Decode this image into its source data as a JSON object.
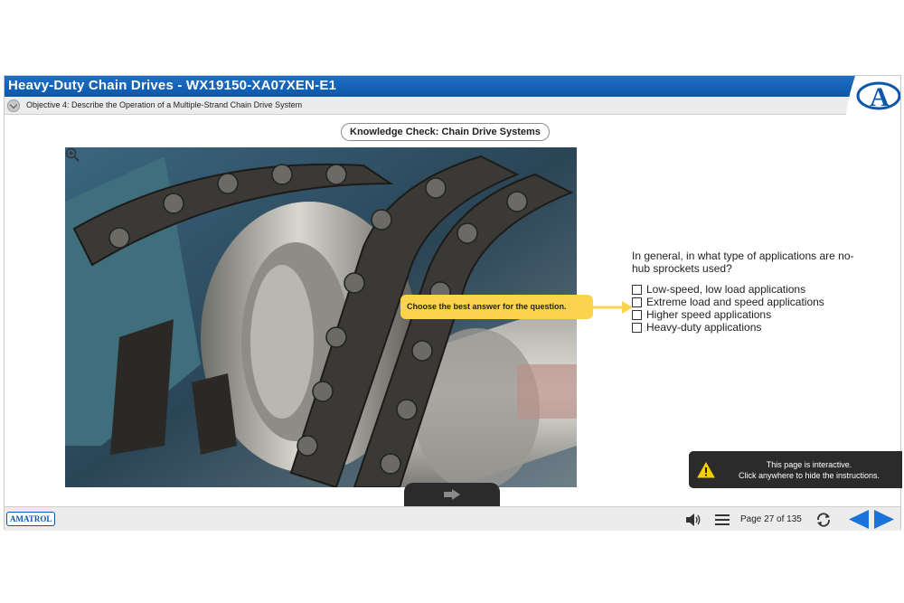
{
  "window": {
    "title": "Heavy-Duty Chain Drives - WX19150-XA07XEN-E1",
    "objective": "Objective 4: Describe the Operation of a Multiple-Strand Chain Drive System",
    "logo_letter": "A"
  },
  "content": {
    "section_title": "Knowledge Check: Chain Drive Systems",
    "photo_icon": "zoom-in-icon",
    "callout": "Choose the best answer for the question.",
    "question": "In general, in what type of applications are no-hub sprockets used?",
    "options": [
      "Low-speed, low load applications",
      "Extreme load and speed applications",
      "Higher speed applications",
      "Heavy-duty applications"
    ]
  },
  "notice": {
    "line1": "This page is interactive.",
    "line2": "Click anywhere to hide the instructions."
  },
  "footer": {
    "brand": "AMATROL",
    "page_label": "Page 27 of 135",
    "icons": [
      "speaker-icon",
      "menu-icon",
      "refresh-icon",
      "prev-arrow-icon",
      "next-arrow-icon"
    ]
  },
  "colors": {
    "title_bar": "#0b57ab",
    "callout": "#fcd34d",
    "nav_arrow": "#1a73d9",
    "notice_bg": "#2b2b2b"
  }
}
